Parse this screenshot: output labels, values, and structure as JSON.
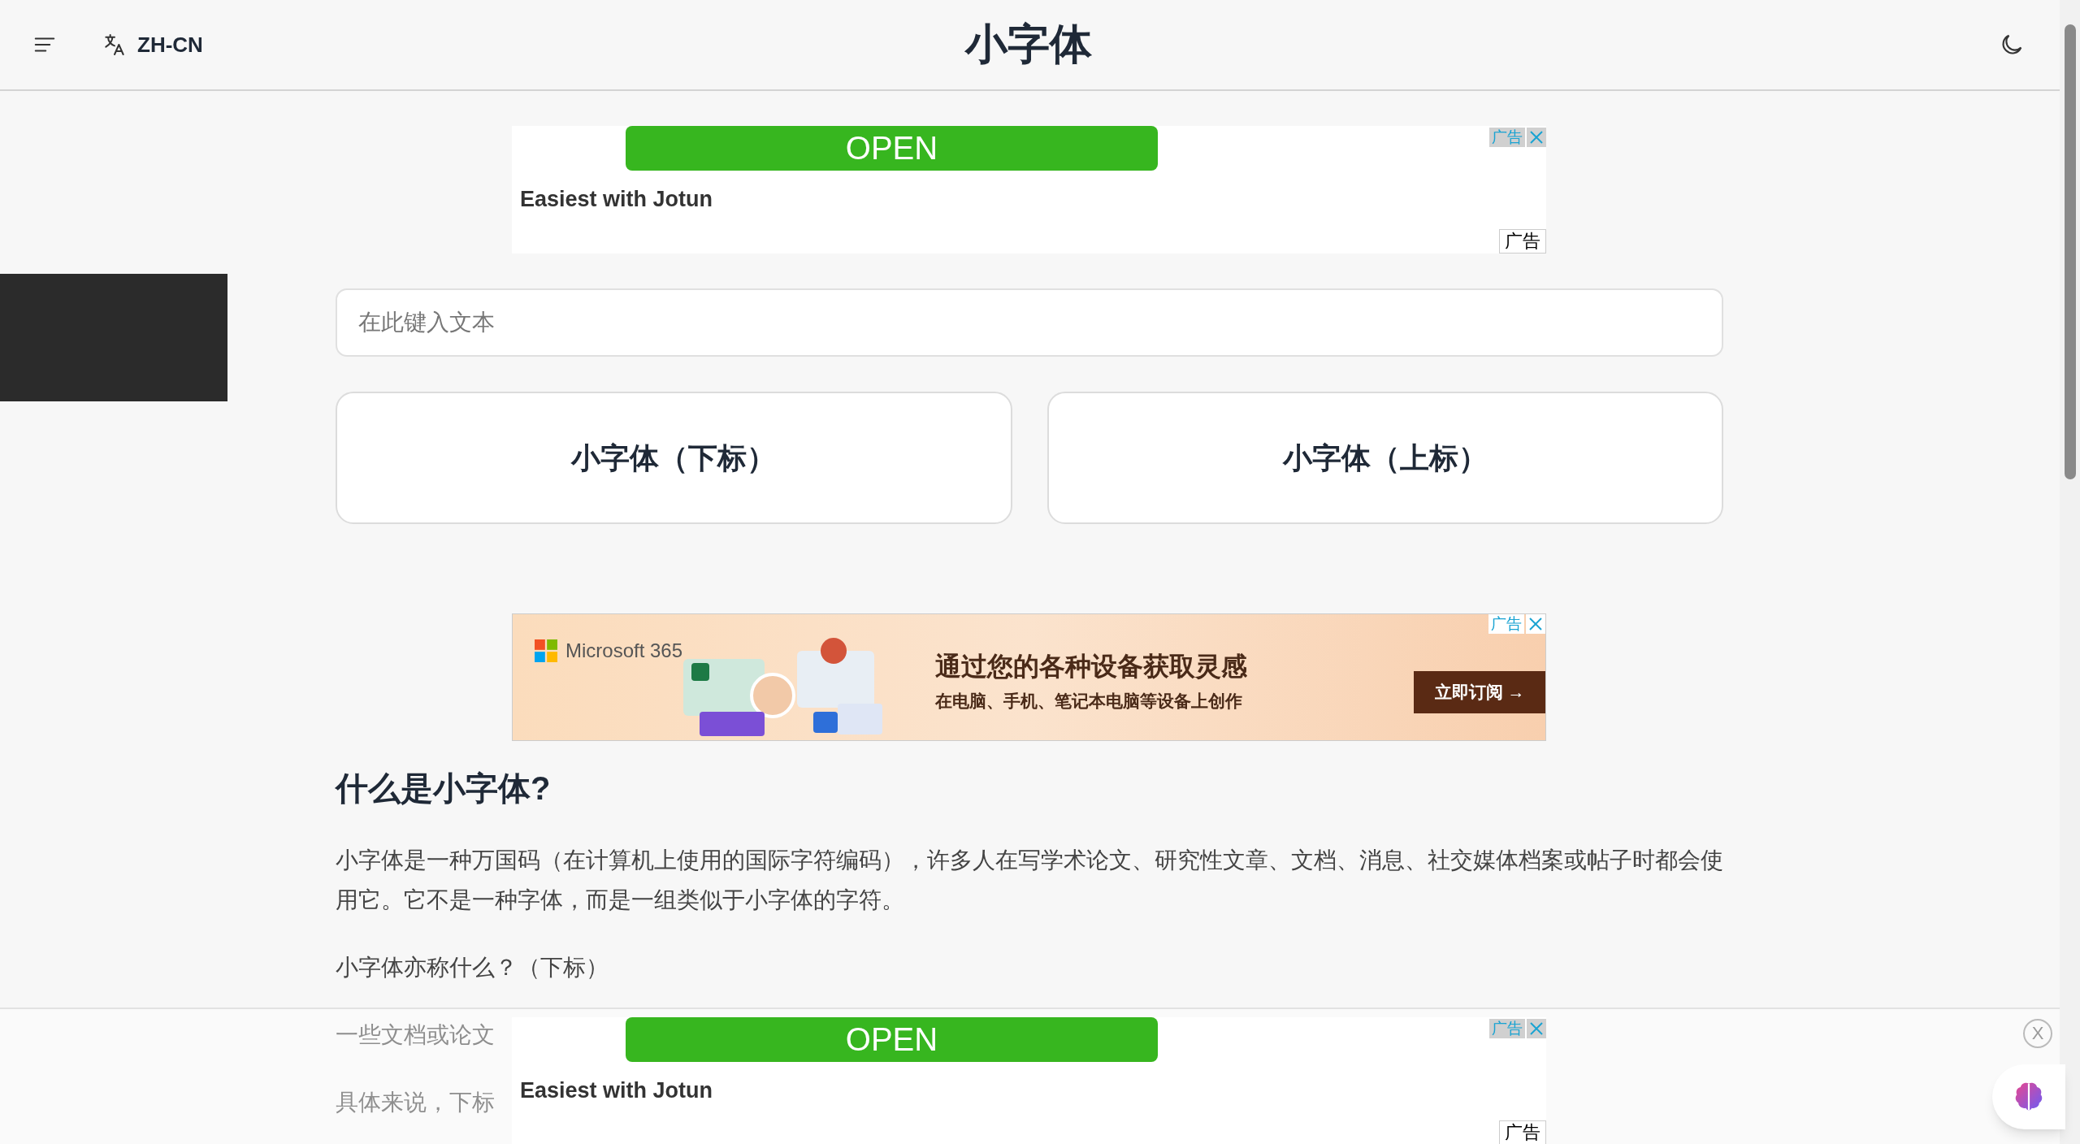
{
  "header": {
    "language": "ZH-CN",
    "title": "小字体"
  },
  "top_ad": {
    "button": "OPEN",
    "headline": "Easiest with Jotun",
    "ad_label": "广告",
    "footer_label": "广告"
  },
  "input": {
    "placeholder": "在此键入文本"
  },
  "buttons": [
    "小字体（下标）",
    "小字体（上标）"
  ],
  "banner_ad": {
    "brand": "Microsoft 365",
    "headline": "通过您的各种设备获取灵感",
    "subline": "在电脑、手机、笔记本电脑等设备上创作",
    "cta": "立即订阅 →",
    "ad_label": "广告"
  },
  "article": {
    "heading": "什么是小字体?",
    "paragraphs": [
      "小字体是一种万国码（在计算机上使用的国际字符编码），许多人在写学术论文、研究性文章、文档、消息、社交媒体档案或帖子时都会使用它。它不是一种字体，而是一组类似于小字体的字符。",
      "小字体亦称什么？（下标）",
      "一些文档或论文",
      "具体来说，下标"
    ]
  },
  "sticky_ad": {
    "button": "OPEN",
    "headline": "Easiest with Jotun",
    "ad_label": "广告",
    "footer_label": "广告",
    "close": "X"
  }
}
